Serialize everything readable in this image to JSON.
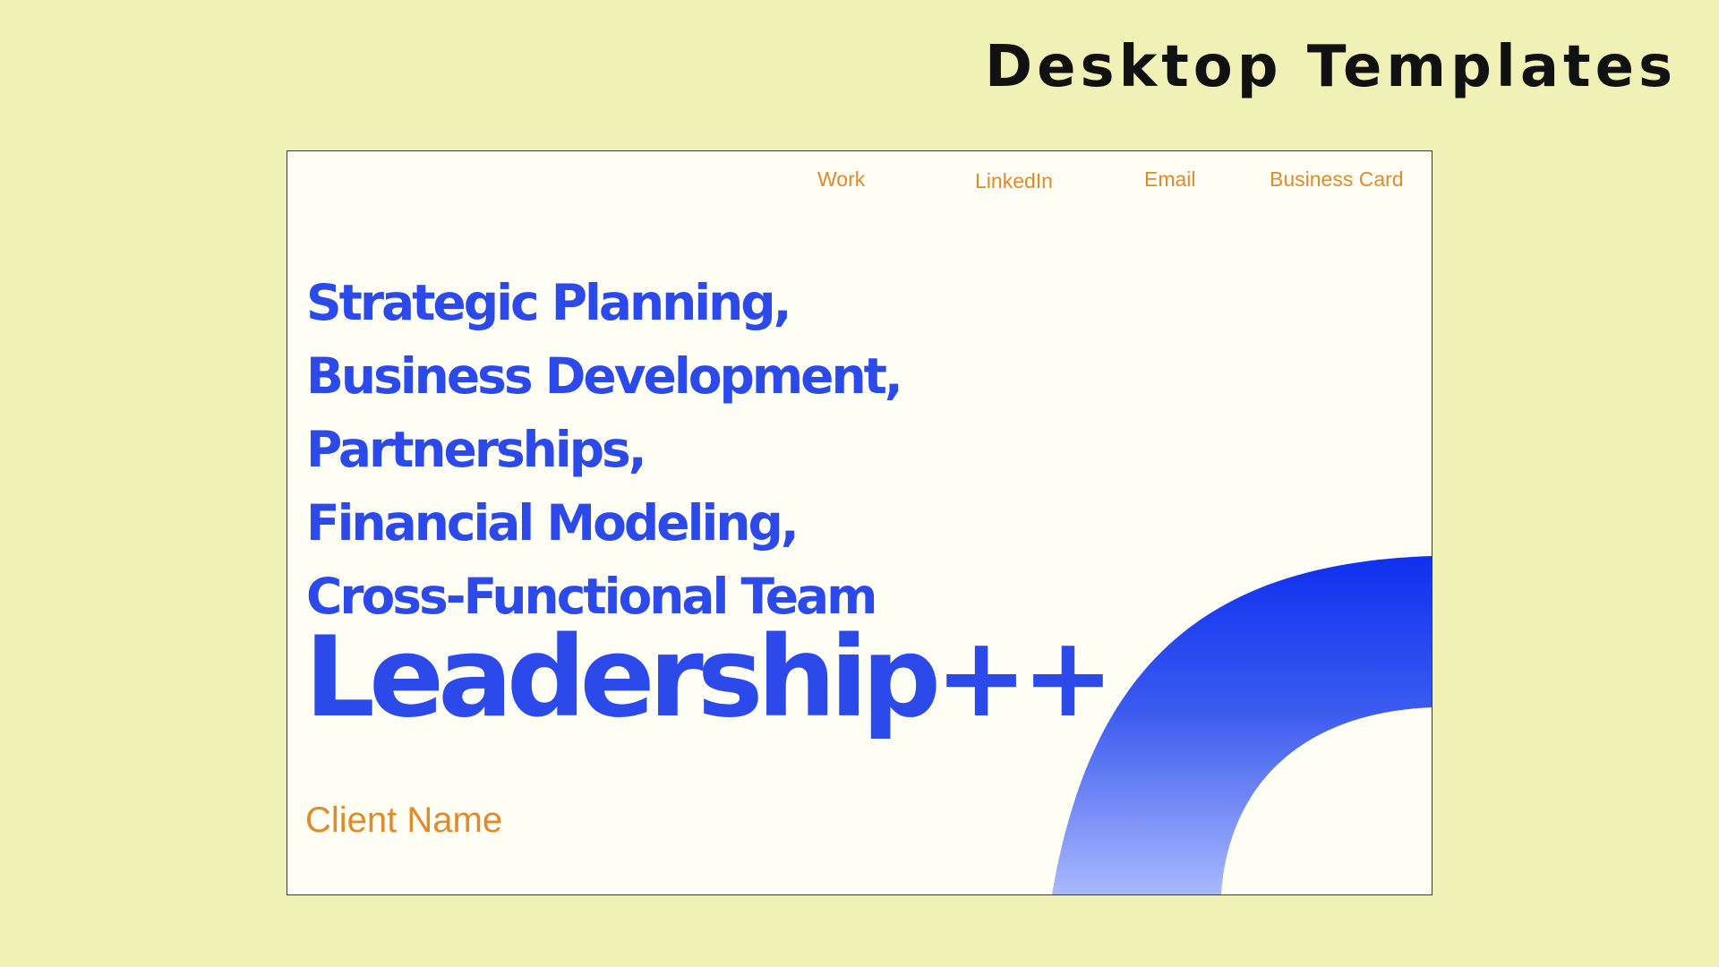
{
  "page": {
    "heading": "Desktop Templates"
  },
  "nav": {
    "items": [
      {
        "label": "Work"
      },
      {
        "label": "LinkedIn"
      },
      {
        "label": "Email"
      },
      {
        "label": "Business Card"
      }
    ]
  },
  "hero": {
    "skills": [
      "Strategic Planning,",
      "Business Development,",
      "Partnerships,",
      "Financial Modeling,",
      "Cross-Functional Team"
    ],
    "headline": "Leadership++",
    "client_name": "Client Name"
  },
  "colors": {
    "background": "#eff1b7",
    "card_background": "#fefef4",
    "accent_blue": "#2b4ae9",
    "accent_orange": "#e08a2b",
    "heading_text": "#111111"
  }
}
